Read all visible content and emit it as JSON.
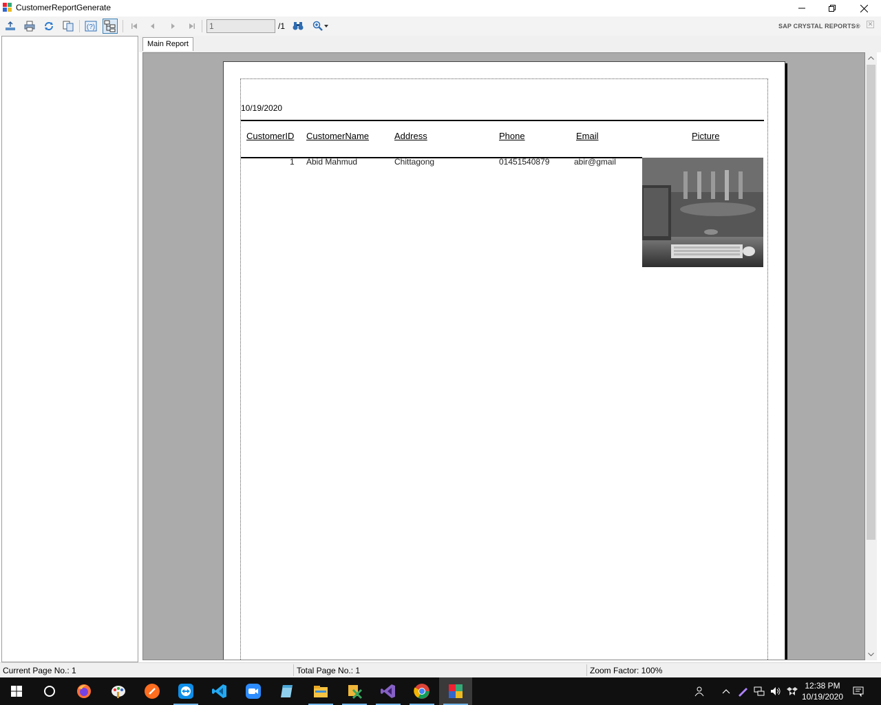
{
  "window": {
    "title": "CustomerReportGenerate"
  },
  "toolbar": {
    "page_input_value": "1",
    "page_total": "/1",
    "brand": "SAP CRYSTAL REPORTS®"
  },
  "tabs": [
    {
      "label": "Main Report"
    }
  ],
  "report": {
    "date": "10/19/2020",
    "columns": [
      "CustomerID",
      "CustomerName",
      "Address",
      "Phone",
      "Email",
      "Picture"
    ],
    "rows": [
      {
        "id": "1",
        "name": "Abid Mahmud",
        "address": "Chittagong",
        "phone": "01451540879",
        "email": "abir@gmail"
      }
    ]
  },
  "status": {
    "current_page": "Current Page No.: 1",
    "total_page": "Total Page No.: 1",
    "zoom": "Zoom Factor: 100%"
  },
  "taskbar": {
    "time": "12:38 PM",
    "date": "10/19/2020",
    "apps": [
      "firefox-icon",
      "paint-icon",
      "sublime-icon",
      "teamviewer-icon",
      "vscode-icon",
      "zoom-icon",
      "notepad-icon",
      "file-explorer-icon",
      "xampp-icon",
      "visual-studio-icon",
      "chrome-icon",
      "report-app-icon"
    ]
  },
  "colors": {
    "accent": "#3c7fb1",
    "viewport_bg": "#ababab",
    "taskbar_bg": "#101010"
  }
}
